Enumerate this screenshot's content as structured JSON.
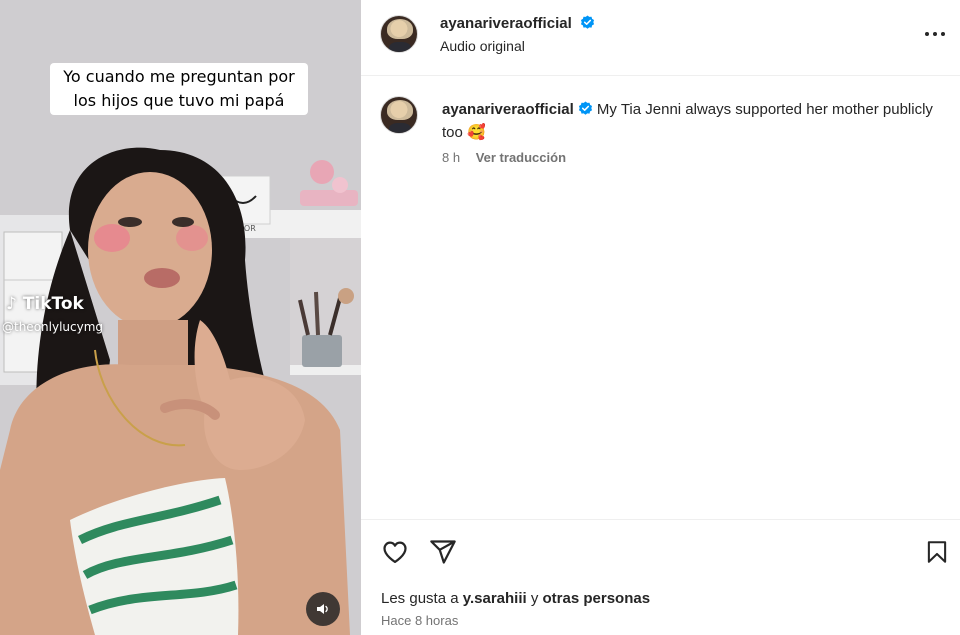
{
  "media": {
    "caption": "Yo cuando me preguntan por los hijos que tuvo mi papá",
    "watermark_brand": "TikTok",
    "watermark_user": "@theonlylucymg",
    "bag_text": "PANDOR"
  },
  "header": {
    "username": "ayanariveraofficial",
    "subtitle": "Audio original"
  },
  "comment": {
    "username": "ayanariveraofficial",
    "text": "My Tia Jenni always supported her mother publicly too 🥰",
    "age": "8 h",
    "translate": "Ver traducción"
  },
  "footer": {
    "likes_prefix": "Les gusta a",
    "likes_user": "y.sarahiii",
    "likes_join": "y",
    "likes_others": "otras personas",
    "timestamp": "Hace 8 horas"
  },
  "colors": {
    "verified": "#0095f6",
    "text": "#262626",
    "muted": "#737373",
    "divider": "#efefef"
  },
  "icons": [
    "volume-icon",
    "verified-badge-icon",
    "more-options-icon",
    "heart-icon",
    "share-icon",
    "bookmark-icon",
    "tiktok-icon"
  ]
}
